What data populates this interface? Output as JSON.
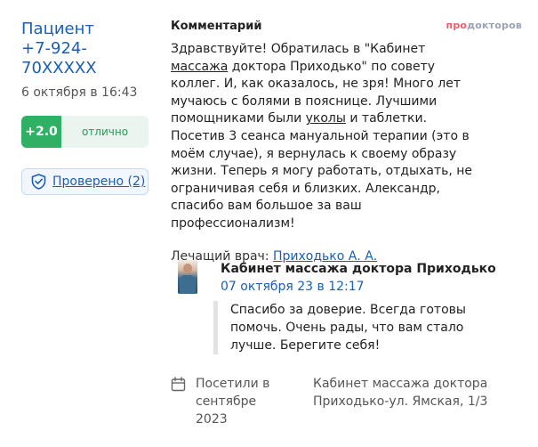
{
  "review": {
    "patient": "Пациент",
    "phone": "+7-924-70XXXXX",
    "date": "6 октября в 16:43",
    "rating_score": "+2.0",
    "rating_label": "отлично",
    "verified_label": "Проверено (2)",
    "comment_heading": "Комментарий",
    "brand_pro": "про",
    "brand_doc": "докторов",
    "comment_parts": {
      "p1": "Здравствуйте! Обратилась в \"Кабинет ",
      "u1": "массажа",
      "p2": " доктора Приходько\" по совету коллег. И, как оказалось, не зря! Много лет мучаюсь с болями в пояснице. Лучшими помощниками были ",
      "u2": "уколы",
      "p3": " и таблетки. Посетив 3 сеанса мануальной терапии (это в моём случае), я вернулась к своему образу жизни. Теперь я могу работать, отдыхать, не ограничивая себя и близких. Александр, спасибо вам большое за ваш профессионализм!"
    },
    "doctor_label": "Лечащий врач:",
    "doctor_name": "Приходько А. А."
  },
  "reply": {
    "author": "Кабинет массажа доктора Приходько",
    "date": "07 октября 23 в 12:17",
    "text": "Спасибо за доверие. Всегда готовы помочь. Очень рады, что вам стало лучше. Берегите себя!"
  },
  "footer": {
    "visited_line1": "Посетили в",
    "visited_line2": "сентябре",
    "visited_line3": "2023",
    "clinic_line1": "Кабинет массажа доктора",
    "clinic_line2": "Приходько-ул. Ямская, 1/3"
  },
  "icons": {
    "shield": "shield-icon",
    "calendar": "calendar-icon"
  },
  "colors": {
    "link": "#1a5fb4",
    "rating_green": "#2fb065",
    "brand_pink": "#f45b69"
  }
}
